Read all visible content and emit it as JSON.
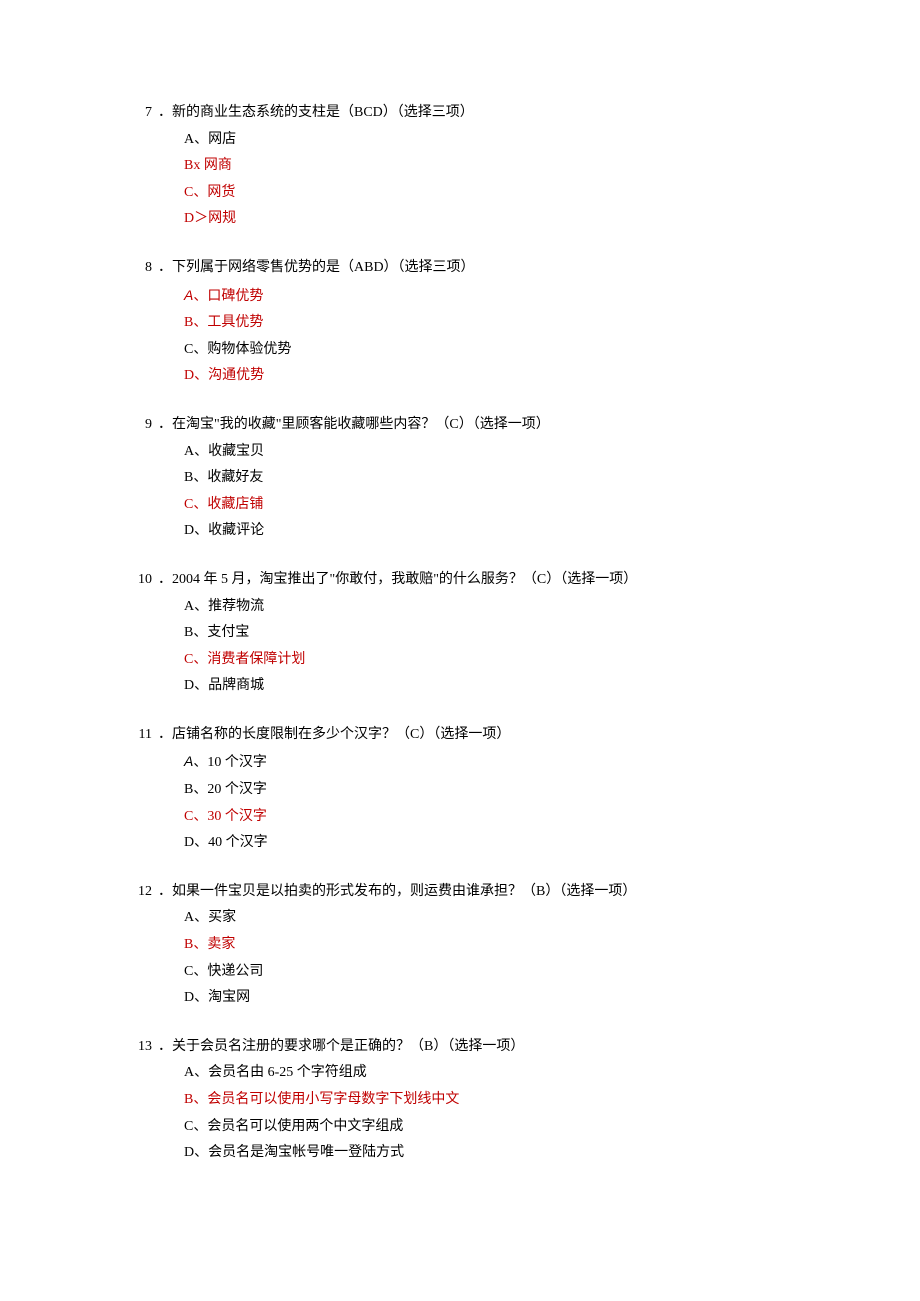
{
  "questions": [
    {
      "num": "7",
      "stem": "．新的商业生态系统的支柱是（BCD）（选择三项）",
      "options": [
        {
          "text": "A、网店",
          "correct": false
        },
        {
          "text": "Bx 网商",
          "correct": true
        },
        {
          "text": "C、网货",
          "correct": true
        },
        {
          "text": "D＞网规",
          "correct": true
        }
      ]
    },
    {
      "num": "8",
      "stem": "．下列属于网络零售优势的是（ABD）（选择三项）",
      "options": [
        {
          "text": "A、口碑优势",
          "correct": true,
          "sansPrefix": true
        },
        {
          "text": "B、工具优势",
          "correct": true
        },
        {
          "text": "C、购物体验优势",
          "correct": false
        },
        {
          "text": "D、沟通优势",
          "correct": true
        }
      ]
    },
    {
      "num": "9",
      "stem": "．在淘宝\"我的收藏\"里顾客能收藏哪些内容？（C）（选择一项）",
      "options": [
        {
          "text": "A、收藏宝贝",
          "correct": false
        },
        {
          "text": "B、收藏好友",
          "correct": false
        },
        {
          "text": "C、收藏店铺",
          "correct": true
        },
        {
          "text": "D、收藏评论",
          "correct": false
        }
      ]
    },
    {
      "num": "10",
      "stem": "．2004 年 5 月，淘宝推出了\"你敢付，我敢赔\"的什么服务？（C）（选择一项）",
      "options": [
        {
          "text": "A、推荐物流",
          "correct": false
        },
        {
          "text": "B、支付宝",
          "correct": false
        },
        {
          "text": "C、消费者保障计划",
          "correct": true
        },
        {
          "text": "D、品牌商城",
          "correct": false
        }
      ]
    },
    {
      "num": "11",
      "stem": "．店铺名称的长度限制在多少个汉字？（C）（选择一项）",
      "options": [
        {
          "text": "A、10 个汉字",
          "correct": false,
          "sansPrefix": true
        },
        {
          "text": "B、20 个汉字",
          "correct": false
        },
        {
          "text": "C、30 个汉字",
          "correct": true
        },
        {
          "text": "D、40 个汉字",
          "correct": false
        }
      ]
    },
    {
      "num": "12",
      "stem": "．如果一件宝贝是以拍卖的形式发布的，则运费由谁承担？（B）（选择一项）",
      "options": [
        {
          "text": "A、买家",
          "correct": false
        },
        {
          "text": "B、卖家",
          "correct": true
        },
        {
          "text": "C、快递公司",
          "correct": false
        },
        {
          "text": "D、淘宝网",
          "correct": false
        }
      ]
    },
    {
      "num": "13",
      "stem": "．关于会员名注册的要求哪个是正确的？（B）（选择一项）",
      "options": [
        {
          "text": "A、会员名由 6-25 个字符组成",
          "correct": false
        },
        {
          "text": "B、会员名可以使用小写字母数字下划线中文",
          "correct": true
        },
        {
          "text": "C、会员名可以使用两个中文字组成",
          "correct": false
        },
        {
          "text": "D、会员名是淘宝帐号唯一登陆方式",
          "correct": false
        }
      ]
    }
  ]
}
